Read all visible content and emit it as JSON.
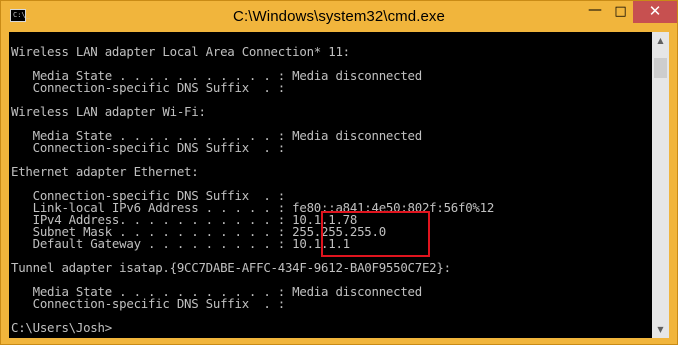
{
  "window": {
    "title": "C:\\Windows\\system32\\cmd.exe",
    "icon": "cmd-icon",
    "controls": {
      "minimize": "minimize-icon",
      "maximize": "maximize-icon",
      "close": "close-icon"
    }
  },
  "console": {
    "lines": [
      "Wireless LAN adapter Local Area Connection* 11:",
      "",
      "   Media State . . . . . . . . . . . : Media disconnected",
      "   Connection-specific DNS Suffix  . :",
      "",
      "Wireless LAN adapter Wi-Fi:",
      "",
      "   Media State . . . . . . . . . . . : Media disconnected",
      "   Connection-specific DNS Suffix  . :",
      "",
      "Ethernet adapter Ethernet:",
      "",
      "   Connection-specific DNS Suffix  . :",
      "   Link-local IPv6 Address . . . . . : fe80::a841:4e50:802f:56f0%12",
      "   IPv4 Address. . . . . . . . . . . : 10.1.1.78",
      "   Subnet Mask . . . . . . . . . . . : 255.255.255.0",
      "   Default Gateway . . . . . . . . . : 10.1.1.1",
      "",
      "Tunnel adapter isatap.{9CC7DABE-AFFC-434F-9612-BA0F9550C7E2}:",
      "",
      "   Media State . . . . . . . . . . . : Media disconnected",
      "   Connection-specific DNS Suffix  . :",
      "",
      "C:\\Users\\Josh>"
    ]
  },
  "colors": {
    "titlebar": "#f1b53c",
    "console_bg": "#000000",
    "console_fg": "#c0c0c0",
    "highlight_border": "#e0141e",
    "close_button": "#c75050"
  }
}
